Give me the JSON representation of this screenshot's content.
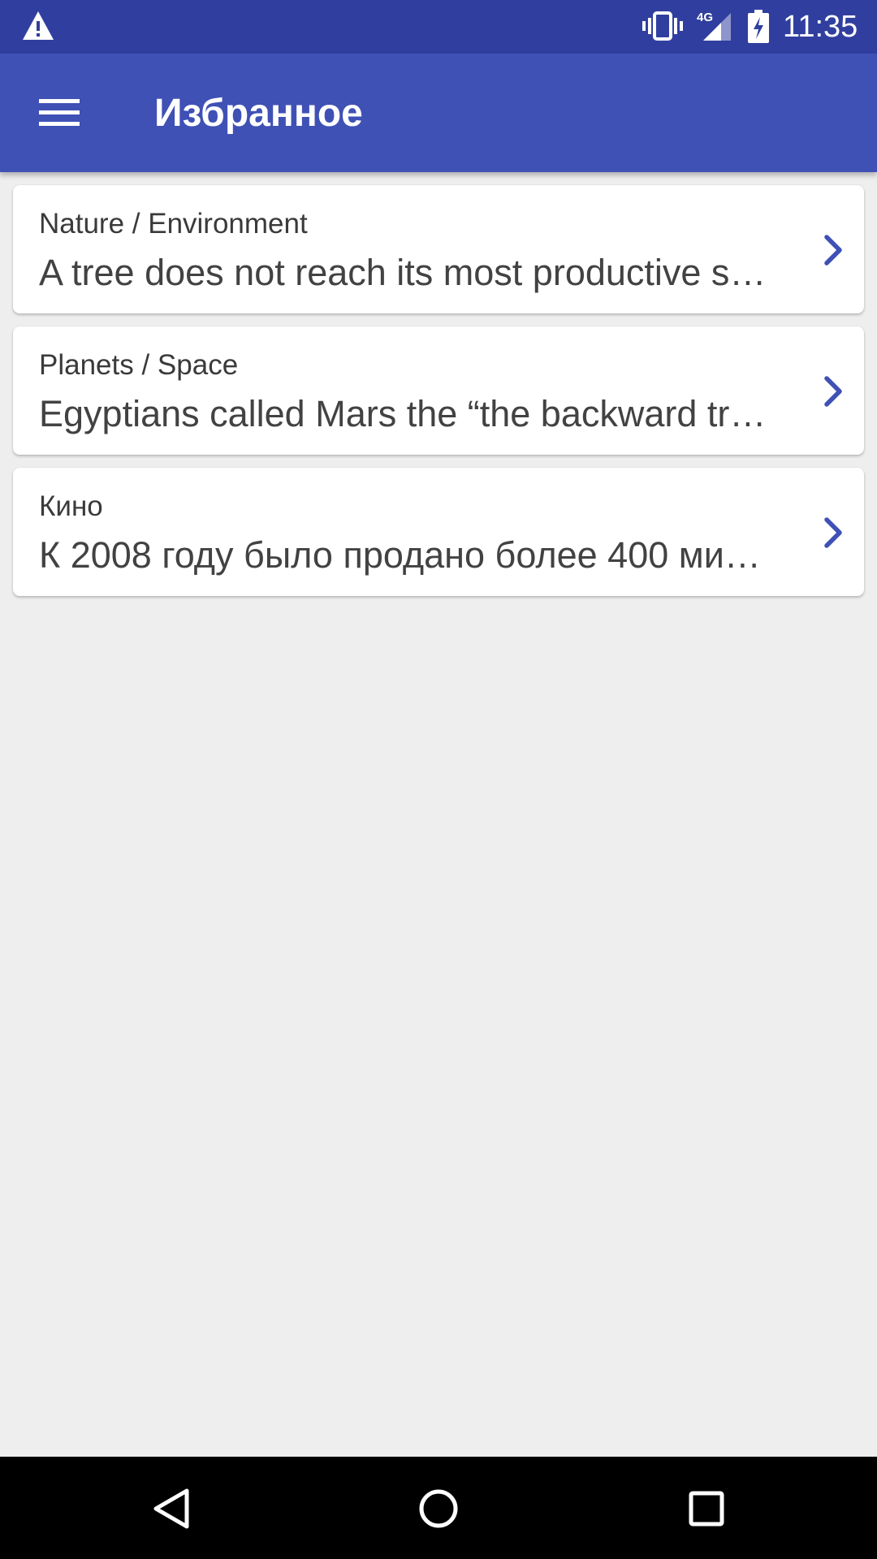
{
  "status_bar": {
    "time": "11:35",
    "network_label": "4G",
    "icons": [
      "warning-icon",
      "vibrate-icon",
      "signal-icon",
      "battery-charging-icon"
    ]
  },
  "app_bar": {
    "title": "Избранное",
    "menu_icon": "menu-icon"
  },
  "favorites": [
    {
      "category": "Nature / Environment",
      "text": "A tree does not reach its most productive s…"
    },
    {
      "category": "Planets / Space",
      "text": "Egyptians called Mars the “the backward tr…"
    },
    {
      "category": "Кино",
      "text": "К 2008 году было продано более 400 ми…"
    }
  ],
  "nav_bar": {
    "icons": [
      "back-icon",
      "home-icon",
      "recents-icon"
    ]
  },
  "colors": {
    "status_bar": "#303f9f",
    "app_bar": "#3f51b5",
    "accent": "#3f51b5",
    "background": "#eeeeee"
  }
}
